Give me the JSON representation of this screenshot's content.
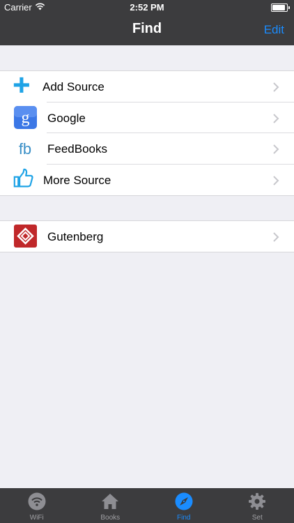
{
  "status_bar": {
    "carrier": "Carrier",
    "time": "2:52 PM"
  },
  "nav": {
    "title": "Find",
    "edit_label": "Edit"
  },
  "sources": [
    {
      "label": "Add Source",
      "icon": "plus-icon"
    },
    {
      "label": "Google",
      "icon": "google-icon"
    },
    {
      "label": "FeedBooks",
      "icon": "feedbooks-icon"
    },
    {
      "label": "More Source",
      "icon": "thumbs-up-icon"
    }
  ],
  "catalogs": [
    {
      "label": "Gutenberg",
      "icon": "gutenberg-icon"
    }
  ],
  "tabs": [
    {
      "label": "WiFi",
      "icon": "wifi-icon",
      "active": false
    },
    {
      "label": "Books",
      "icon": "home-icon",
      "active": false
    },
    {
      "label": "Find",
      "icon": "compass-icon",
      "active": true
    },
    {
      "label": "Set",
      "icon": "gear-icon",
      "active": false
    }
  ],
  "colors": {
    "accent": "#1a8cff",
    "bar": "#3c3c3e",
    "background": "#efeff4"
  }
}
